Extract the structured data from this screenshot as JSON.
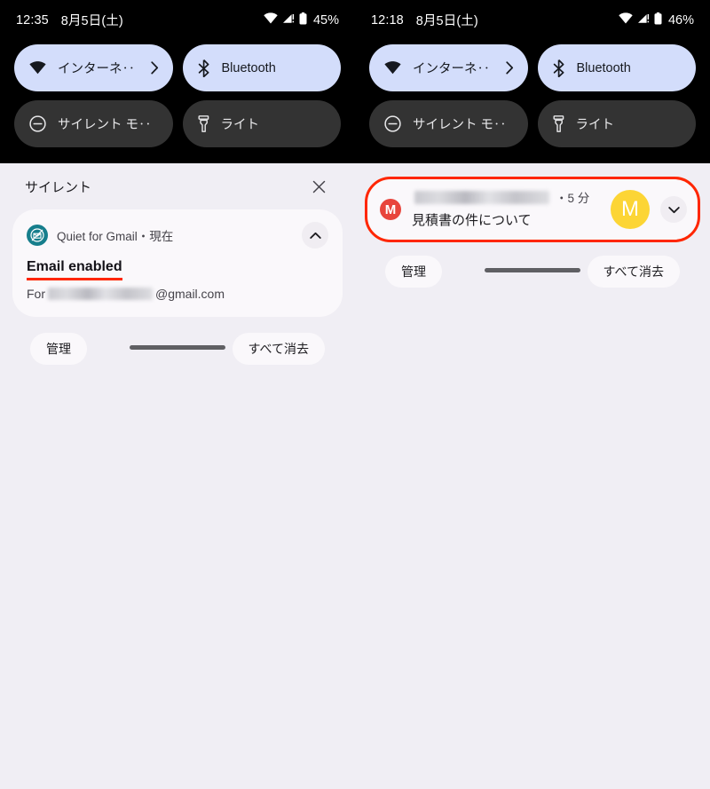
{
  "screens": [
    {
      "id": "left",
      "status_bar": {
        "time": "12:35",
        "date": "8月5日(土)",
        "wifi_icon": "wifi-icon",
        "signal_icon": "cellular-signal-icon",
        "battery_icon": "battery-icon",
        "battery_level": "45%"
      },
      "quick_settings": {
        "tiles": [
          {
            "label": "インターネ‥",
            "icon": "wifi-icon",
            "state": "active",
            "has_chevron": true,
            "chevron_icon": "chevron-right-icon"
          },
          {
            "label": "Bluetooth",
            "icon": "bluetooth-icon",
            "state": "active",
            "has_chevron": false
          },
          {
            "label": "サイレント モ‥",
            "icon": "do-not-disturb-icon",
            "state": "inactive",
            "has_chevron": false
          },
          {
            "label": "ライト",
            "icon": "flashlight-icon",
            "state": "inactive",
            "has_chevron": false
          }
        ]
      },
      "shade": {
        "title": "サイレント",
        "close_icon": "close-icon",
        "notification": {
          "app_icon": "quiet-for-gmail-icon",
          "app_name": "Quiet for Gmail・現在",
          "expand_icon": "chevron-up-icon",
          "title": "Email enabled",
          "body_prefix": "For",
          "body_redacted": true,
          "body_suffix": "@gmail.com"
        },
        "actions": {
          "manage": "管理",
          "clear_all": "すべて消去"
        }
      },
      "nav_handle": "home-gesture-handle"
    },
    {
      "id": "right",
      "status_bar": {
        "time": "12:18",
        "date": "8月5日(土)",
        "wifi_icon": "wifi-icon",
        "signal_icon": "cellular-signal-icon",
        "battery_icon": "battery-icon",
        "battery_level": "46%"
      },
      "quick_settings": {
        "tiles": [
          {
            "label": "インターネ‥",
            "icon": "wifi-icon",
            "state": "active",
            "has_chevron": true,
            "chevron_icon": "chevron-right-icon"
          },
          {
            "label": "Bluetooth",
            "icon": "bluetooth-icon",
            "state": "active",
            "has_chevron": false
          },
          {
            "label": "サイレント モ‥",
            "icon": "do-not-disturb-icon",
            "state": "inactive",
            "has_chevron": false
          },
          {
            "label": "ライト",
            "icon": "flashlight-icon",
            "state": "inactive",
            "has_chevron": false
          }
        ]
      },
      "shade": {
        "notification": {
          "app_icon": "gmail-icon",
          "app_icon_letter": "M",
          "sender_redacted": true,
          "time": "・5 分",
          "subject": "見積書の件について",
          "avatar_letter": "M",
          "expand_icon": "chevron-down-icon",
          "highlighted": true
        },
        "actions": {
          "manage": "管理",
          "clear_all": "すべて消去"
        }
      },
      "nav_handle": "home-gesture-handle"
    }
  ],
  "colors": {
    "tile_active_bg": "#d3ddfb",
    "tile_inactive_bg": "#333333",
    "shade_bg": "#f0eef4",
    "card_bg": "#faf8fb",
    "highlight_red": "#ff2600",
    "gmail_red": "#e8453c",
    "avatar_yellow": "#fcd535",
    "quiet_teal": "#167e8c",
    "status_bar_bg": "#000000"
  }
}
